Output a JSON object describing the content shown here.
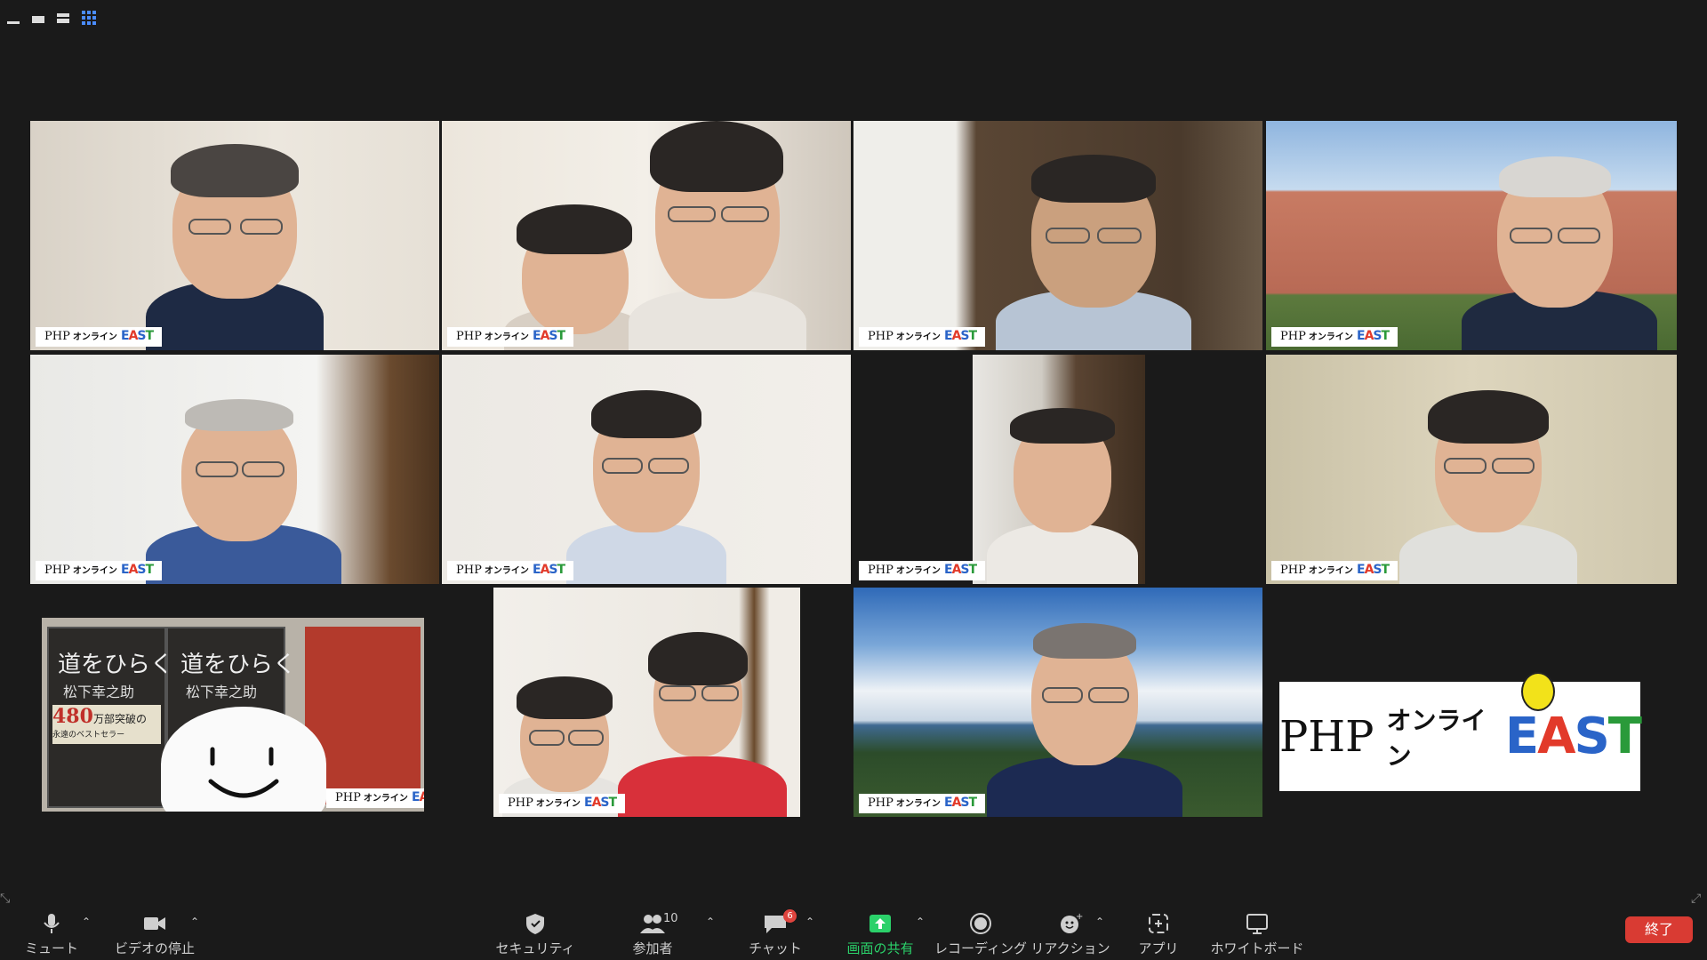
{
  "view_controls": {
    "items": [
      {
        "icon": "minimize-icon"
      },
      {
        "icon": "speaker-view-icon"
      },
      {
        "icon": "strip-view-icon"
      },
      {
        "icon": "gallery-view-icon"
      }
    ],
    "active_color": "#4a8cff"
  },
  "branding": {
    "tag_php": "PHP",
    "tag_kana": "オンライン",
    "tag_east": [
      "E",
      "A",
      "S",
      "T"
    ]
  },
  "big_logo": {
    "php": "PHP",
    "kana": "オンライン",
    "east": [
      "E",
      "A",
      "S",
      "T"
    ]
  },
  "book": {
    "title_left": "道をひらく",
    "author_left": "松下幸之助",
    "title_right": "道をひらく",
    "author_right": "松下幸之助",
    "banner_number": "480",
    "banner_text": "万部突破の",
    "banner_sub": "永遠のベストセラー"
  },
  "toolbar": {
    "mute": "ミュート",
    "video": "ビデオの停止",
    "security": "セキュリティ",
    "participants": "参加者",
    "participant_count": "10",
    "chat": "チャット",
    "chat_badge": "6",
    "share": "画面の共有",
    "record": "レコーディング",
    "reactions": "リアクション",
    "apps": "アプリ",
    "whiteboard": "ホワイトボード",
    "end": "終了",
    "share_color": "#2bd16a",
    "end_color": "#d93b33"
  },
  "active_speaker_color": "#e8e18a"
}
